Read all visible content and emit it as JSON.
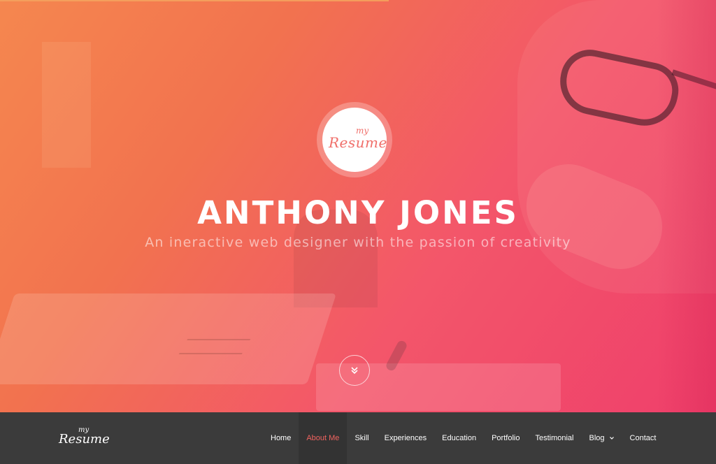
{
  "hero": {
    "logo": {
      "my": "my",
      "resume": "Resume"
    },
    "title": "ANTHONY JONES",
    "subtitle": "An ineractive web designer with the passion of creativity",
    "scroll_icon": "double-chevron-down-icon"
  },
  "navbar": {
    "logo": {
      "my": "my",
      "resume": "Resume"
    },
    "items": [
      {
        "label": "Home"
      },
      {
        "label": "About Me",
        "active": true
      },
      {
        "label": "Skill"
      },
      {
        "label": "Experiences"
      },
      {
        "label": "Education"
      },
      {
        "label": "Portfolio"
      },
      {
        "label": "Testimonial"
      },
      {
        "label": "Blog",
        "has_dropdown": true
      },
      {
        "label": "Contact"
      }
    ]
  },
  "colors": {
    "accent": "#f0635f",
    "gradient_start": "#f5874f",
    "gradient_end": "#ef3f6b",
    "navbar": "#3b3b3b"
  }
}
